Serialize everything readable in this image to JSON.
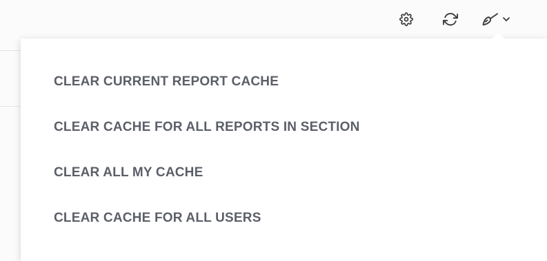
{
  "toolbar": {
    "icons": [
      "gear-icon",
      "refresh-icon",
      "broom-icon",
      "chevron-down-icon"
    ],
    "icon_color": "#3a3a3a"
  },
  "cache_menu": {
    "text_color": "#5b5f68",
    "items": [
      {
        "label": "CLEAR CURRENT REPORT CACHE"
      },
      {
        "label": "CLEAR CACHE FOR ALL REPORTS IN SECTION"
      },
      {
        "label": "CLEAR ALL MY CACHE"
      },
      {
        "label": "CLEAR CACHE FOR ALL USERS"
      }
    ]
  }
}
